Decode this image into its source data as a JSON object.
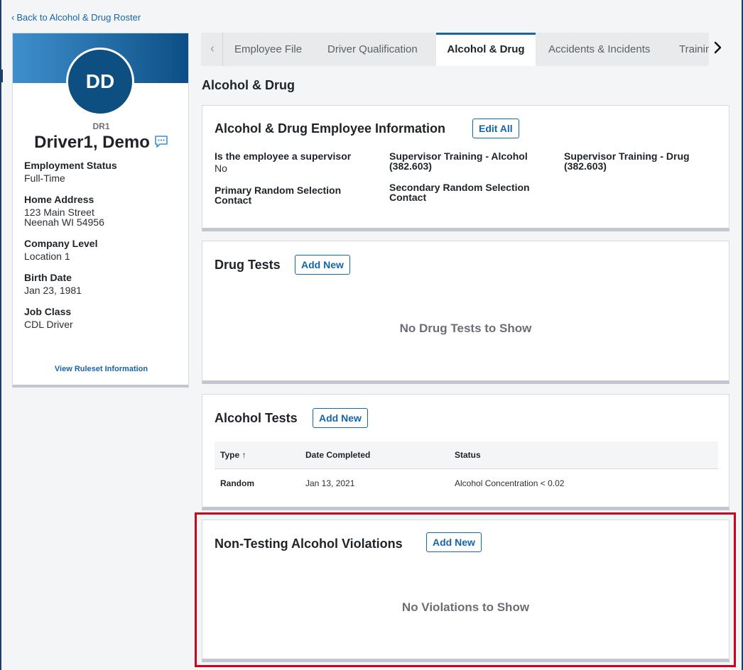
{
  "nav": {
    "back_label": "Back to Alcohol & Drug Roster"
  },
  "profile": {
    "initials": "DD",
    "code": "DR1",
    "name": "Driver1, Demo",
    "fields": [
      {
        "label": "Employment Status",
        "value": "Full-Time"
      },
      {
        "label": "Home Address",
        "value": "123 Main Street",
        "value2": "Neenah WI 54956"
      },
      {
        "label": "Company Level",
        "value": "Location 1"
      },
      {
        "label": "Birth Date",
        "value": "Jan 23, 1981"
      },
      {
        "label": "Job Class",
        "value": "CDL Driver"
      }
    ],
    "ruleset_link": "View Ruleset Information"
  },
  "tabs": [
    {
      "label": "Employee File",
      "active": false
    },
    {
      "label": "Driver Qualification",
      "active": false
    },
    {
      "label": "Alcohol & Drug",
      "active": true
    },
    {
      "label": "Accidents & Incidents",
      "active": false
    },
    {
      "label": "Training",
      "active": false
    }
  ],
  "section_title": "Alcohol & Drug",
  "employee_info": {
    "title": "Alcohol & Drug Employee Information",
    "edit_label": "Edit All",
    "fields": [
      {
        "label": "Is the employee a supervisor",
        "value": "No"
      },
      {
        "label": "Supervisor Training - Alcohol (382.603)",
        "value": ""
      },
      {
        "label": "Supervisor Training - Drug (382.603)",
        "value": ""
      },
      {
        "label": "Primary Random Selection Contact",
        "value": ""
      },
      {
        "label": "Secondary Random Selection Contact",
        "value": ""
      }
    ]
  },
  "drug_tests": {
    "title": "Drug Tests",
    "add_label": "Add New",
    "empty": "No Drug Tests to Show"
  },
  "alcohol_tests": {
    "title": "Alcohol Tests",
    "add_label": "Add New",
    "columns": [
      "Type ↑",
      "Date Completed",
      "Status"
    ],
    "rows": [
      {
        "type": "Random",
        "date": "Jan 13, 2021",
        "status": "Alcohol Concentration < 0.02"
      }
    ]
  },
  "violations": {
    "title": "Non-Testing Alcohol Violations",
    "add_label": "Add New",
    "empty": "No Violations to Show"
  },
  "colors": {
    "accent": "#1565a8",
    "avatar": "#0d4f80",
    "highlight": "#d0021b",
    "banner_start": "#3f8fcd",
    "banner_end": "#0c4f86"
  },
  "icons": {
    "back": "chevron-left-icon",
    "chat": "chat-bubble-icon",
    "tab_prev": "chevron-left-icon",
    "tab_next": "chevron-right-icon"
  }
}
